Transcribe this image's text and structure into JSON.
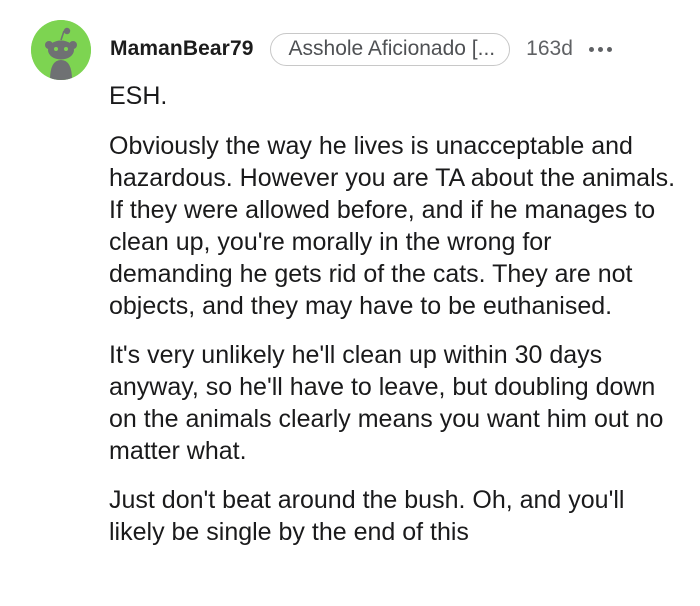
{
  "comment": {
    "author": "MamanBear79",
    "flair": "Asshole Aficionado [...",
    "age": "163d",
    "more_icon": "ellipsis-icon",
    "avatar_icon": "snoo-avatar-icon",
    "avatar_color": "#7dd451",
    "paragraphs": [
      "ESH.",
      "Obviously the way he lives is unacceptable and hazardous. However you are TA about the animals. If they were allowed before, and if he manages to clean up, you're morally in the wrong for demanding he gets rid of the cats. They are not objects, and they may have to be euthanised.",
      "It's very unlikely he'll clean up within 30 days anyway, so he'll have to leave, but doubling down on the animals clearly means you want him out no matter what.",
      "Just don't beat around the bush. Oh, and you'll likely be single by the end of this"
    ]
  }
}
